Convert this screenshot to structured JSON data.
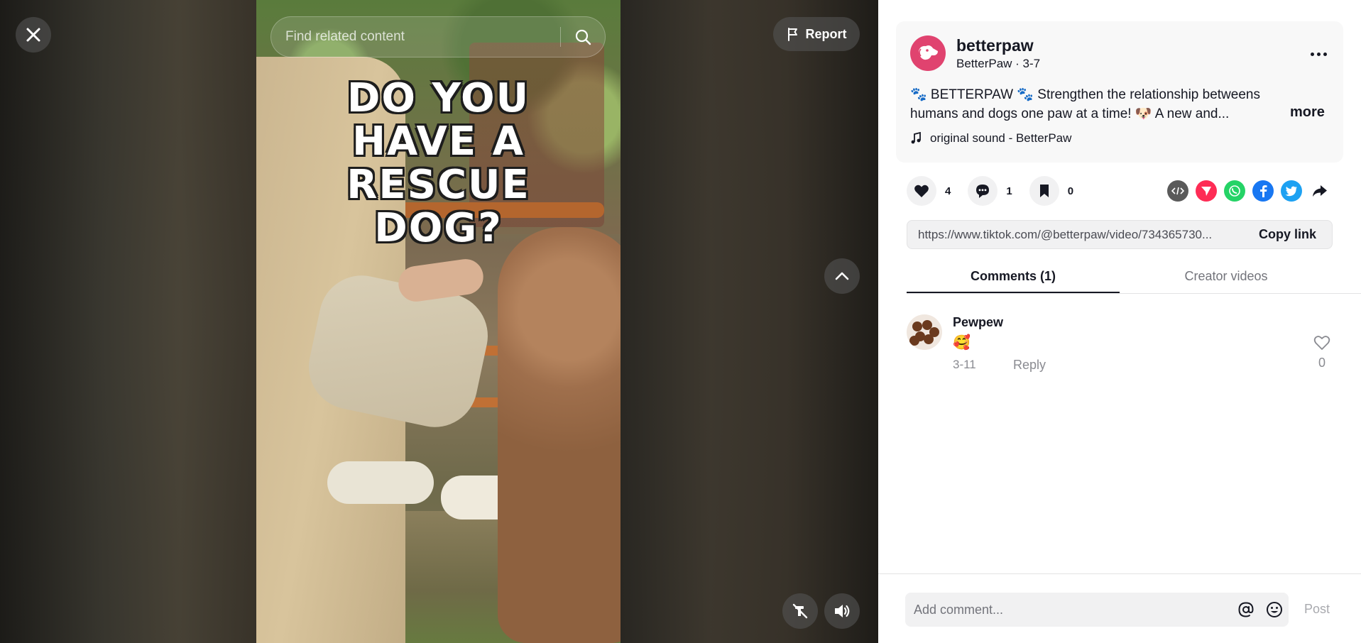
{
  "search": {
    "placeholder": "Find related content"
  },
  "report": {
    "label": "Report"
  },
  "video": {
    "caption_lines": [
      "DO YOU",
      "HAVE A",
      "RESCUE",
      "DOG?"
    ]
  },
  "author": {
    "username": "betterpaw",
    "subline": "BetterPaw · 3-7",
    "description": "🐾 BETTERPAW 🐾 Strengthen the relationship betweens humans and dogs one paw at a time! 🐶 A new and...",
    "more_label": "more",
    "sound": "original sound - BetterPaw"
  },
  "actions": {
    "likes": "4",
    "comments": "1",
    "saves": "0"
  },
  "share_icons": [
    "embed-icon",
    "send-to-friends-icon",
    "whatsapp-icon",
    "facebook-icon",
    "twitter-icon",
    "share-arrow-icon"
  ],
  "link": {
    "url": "https://www.tiktok.com/@betterpaw/video/734365730...",
    "copy_label": "Copy link"
  },
  "tabs": [
    {
      "label": "Comments (1)",
      "active": true
    },
    {
      "label": "Creator videos",
      "active": false
    }
  ],
  "comments": [
    {
      "user": "Pewpew",
      "text": "🥰",
      "date": "3-11",
      "reply_label": "Reply",
      "likes": "0"
    }
  ],
  "composer": {
    "placeholder": "Add comment...",
    "post_label": "Post"
  },
  "colors": {
    "accent_pink": "#e0436f",
    "whatsapp": "#25d366",
    "facebook": "#1877f2",
    "twitter": "#1da1f2",
    "send": "#fe2c55",
    "embed": "#5a5a5a"
  }
}
